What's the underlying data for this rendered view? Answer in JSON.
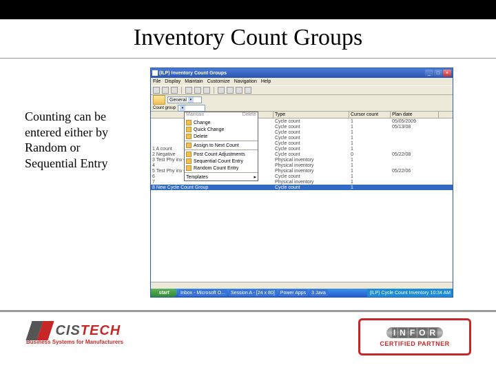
{
  "slide": {
    "title": "Inventory Count Groups",
    "side_text": "Counting can be entered either by Random or Sequential Entry"
  },
  "window": {
    "title": "(ILP) Inventory Count Groups",
    "menu": [
      "File",
      "Display",
      "Maintain",
      "Customize",
      "Navigation",
      "Help"
    ],
    "general_label": "General",
    "count_group_label": "Count group",
    "columns": [
      "",
      "Type",
      "Cursor count",
      "Plan date"
    ],
    "rows": [
      {
        "c1": "",
        "c2": "Cycle count",
        "c3": "1",
        "c4": "05/05/2009"
      },
      {
        "c1": "",
        "c2": "Cycle count",
        "c3": "1",
        "c4": "05/13/08"
      },
      {
        "c1": "",
        "c2": "Cycle count",
        "c3": "1",
        "c4": ""
      },
      {
        "c1": "",
        "c2": "Cycle count",
        "c3": "1",
        "c4": ""
      },
      {
        "c1": "",
        "c2": "Cycle count",
        "c3": "1",
        "c4": ""
      },
      {
        "c1": "1 A count",
        "c2": "Cycle count",
        "c3": "1",
        "c4": ""
      },
      {
        "c1": "2 Negative",
        "c2": "Cycle count",
        "c3": "0",
        "c4": "05/22/08"
      },
      {
        "c1": "3 Test Phy inv 05/23/06",
        "c2": "Physical inventory",
        "c3": "1",
        "c4": ""
      },
      {
        "c1": "4",
        "c2": "Physical inventory",
        "c3": "1",
        "c4": ""
      },
      {
        "c1": "5 Test Phy inv 05/24/06",
        "c2": "Physical inventory",
        "c3": "1",
        "c4": "05/22/06"
      },
      {
        "c1": "6",
        "c2": "Cycle count",
        "c3": "1",
        "c4": ""
      },
      {
        "c1": "7",
        "c2": "Physical inventory",
        "c3": "1",
        "c4": ""
      },
      {
        "c1": "8 New Cycle Count Group",
        "c2": "Cycle count",
        "c3": "1",
        "c4": ""
      }
    ],
    "selected_row": 12,
    "dropdown": {
      "header_left": "Maintain",
      "header_right": "Delete",
      "items": [
        "Change",
        "Quick Change",
        "Delete",
        "Assign to Next Count",
        "Post Count Adjustments",
        "Sequential Count Entry",
        "Random Count Entry"
      ],
      "footer": "Templates"
    },
    "taskbar": {
      "start": "start",
      "buttons": [
        "Inbox - Microsoft O...",
        "Session A - [24 x 80]",
        "Power Apps",
        "3 Java"
      ],
      "tray_app": "(ILP) Cycle Count Inventory",
      "time": "10:34 AM"
    }
  },
  "logos": {
    "left_name_a": "CIS",
    "left_name_b": "TECH",
    "left_tag": "Business Systems for Manufacturers",
    "right_brand": "INFOR",
    "right_sub": "CERTIFIED PARTNER"
  }
}
